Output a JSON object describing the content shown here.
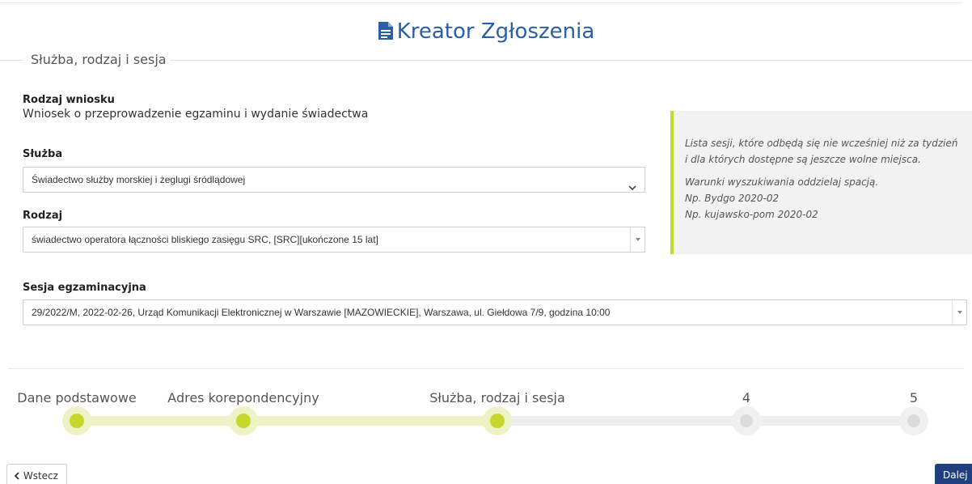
{
  "header": {
    "title": "Kreator Zgłoszenia",
    "icon": "document-icon"
  },
  "section": {
    "legend": "Służba, rodzaj i sesja"
  },
  "request_type": {
    "label": "Rodzaj wniosku",
    "value": "Wniosek o przeprowadzenie egzaminu i wydanie świadectwa"
  },
  "service": {
    "label": "Służba",
    "selected": "Świadectwo służby morskiej i żeglugi śródlądowej"
  },
  "kind": {
    "label": "Rodzaj",
    "selected": "świadectwo operatora łączności bliskiego zasięgu SRC, [SRC][ukończone 15 lat]"
  },
  "info": {
    "line1": "Lista sesji, które odbędą się nie wcześniej niż za tydzień i dla których dostępne są jeszcze wolne miejsca.",
    "line2": "Warunki wyszukiwania oddzielaj spacją.",
    "example1": "Np. Bydgo 2020-02",
    "example2": "Np. kujawsko-pom 2020-02"
  },
  "session": {
    "label": "Sesja egzaminacyjna",
    "selected": "29/2022/M, 2022-02-26, Urząd Komunikacji Elektronicznej w Warszawie [MAZOWIECKIE], Warszawa, ul. Giełdowa 7/9, godzina 10:00"
  },
  "steps": [
    {
      "label": "Dane podstawowe",
      "state": "done"
    },
    {
      "label": "Adres korepondencyjny",
      "state": "done"
    },
    {
      "label": "Służba, rodzaj i sesja",
      "state": "current"
    },
    {
      "label": "4",
      "state": "todo"
    },
    {
      "label": "5",
      "state": "todo"
    }
  ],
  "nav": {
    "back_label": "Wstecz",
    "next_label": "Dalej"
  },
  "colors": {
    "accent": "#c5d92c",
    "title": "#2a5fa8",
    "primary_button": "#1f3f80"
  }
}
